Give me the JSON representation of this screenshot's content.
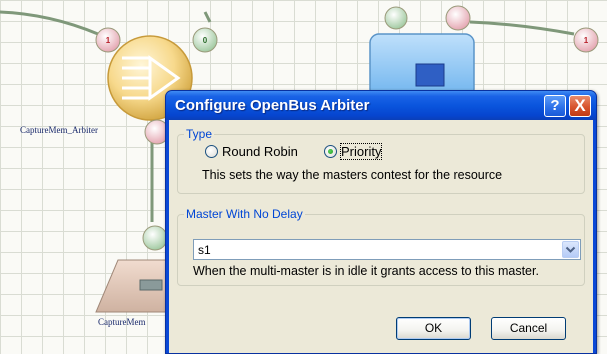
{
  "canvas": {
    "labels": {
      "arbiter": "CaptureMem_Arbiter",
      "capture_mem": "CaptureMem",
      "pin_1": "1",
      "pin_0": "0",
      "pin_1_right": "1"
    }
  },
  "dialog": {
    "title": "Configure OpenBus Arbiter",
    "help_button": "?",
    "close_button": "X",
    "type_group": {
      "legend": "Type",
      "options": [
        {
          "label": "Round Robin",
          "checked": false
        },
        {
          "label": "Priority",
          "checked": true
        }
      ],
      "description": "This sets the way the masters contest for the resource"
    },
    "master_group": {
      "legend": "Master With No Delay",
      "selected": "s1",
      "description": "When the multi-master is in idle it grants access to this master."
    },
    "buttons": {
      "ok": "OK",
      "cancel": "Cancel"
    }
  },
  "colors": {
    "title_bar": "#0a55dd",
    "dialog_face": "#ece9d8",
    "group_legend": "#0046d5",
    "canvas_label": "#1a2a6c",
    "connector": "#7f987a"
  }
}
